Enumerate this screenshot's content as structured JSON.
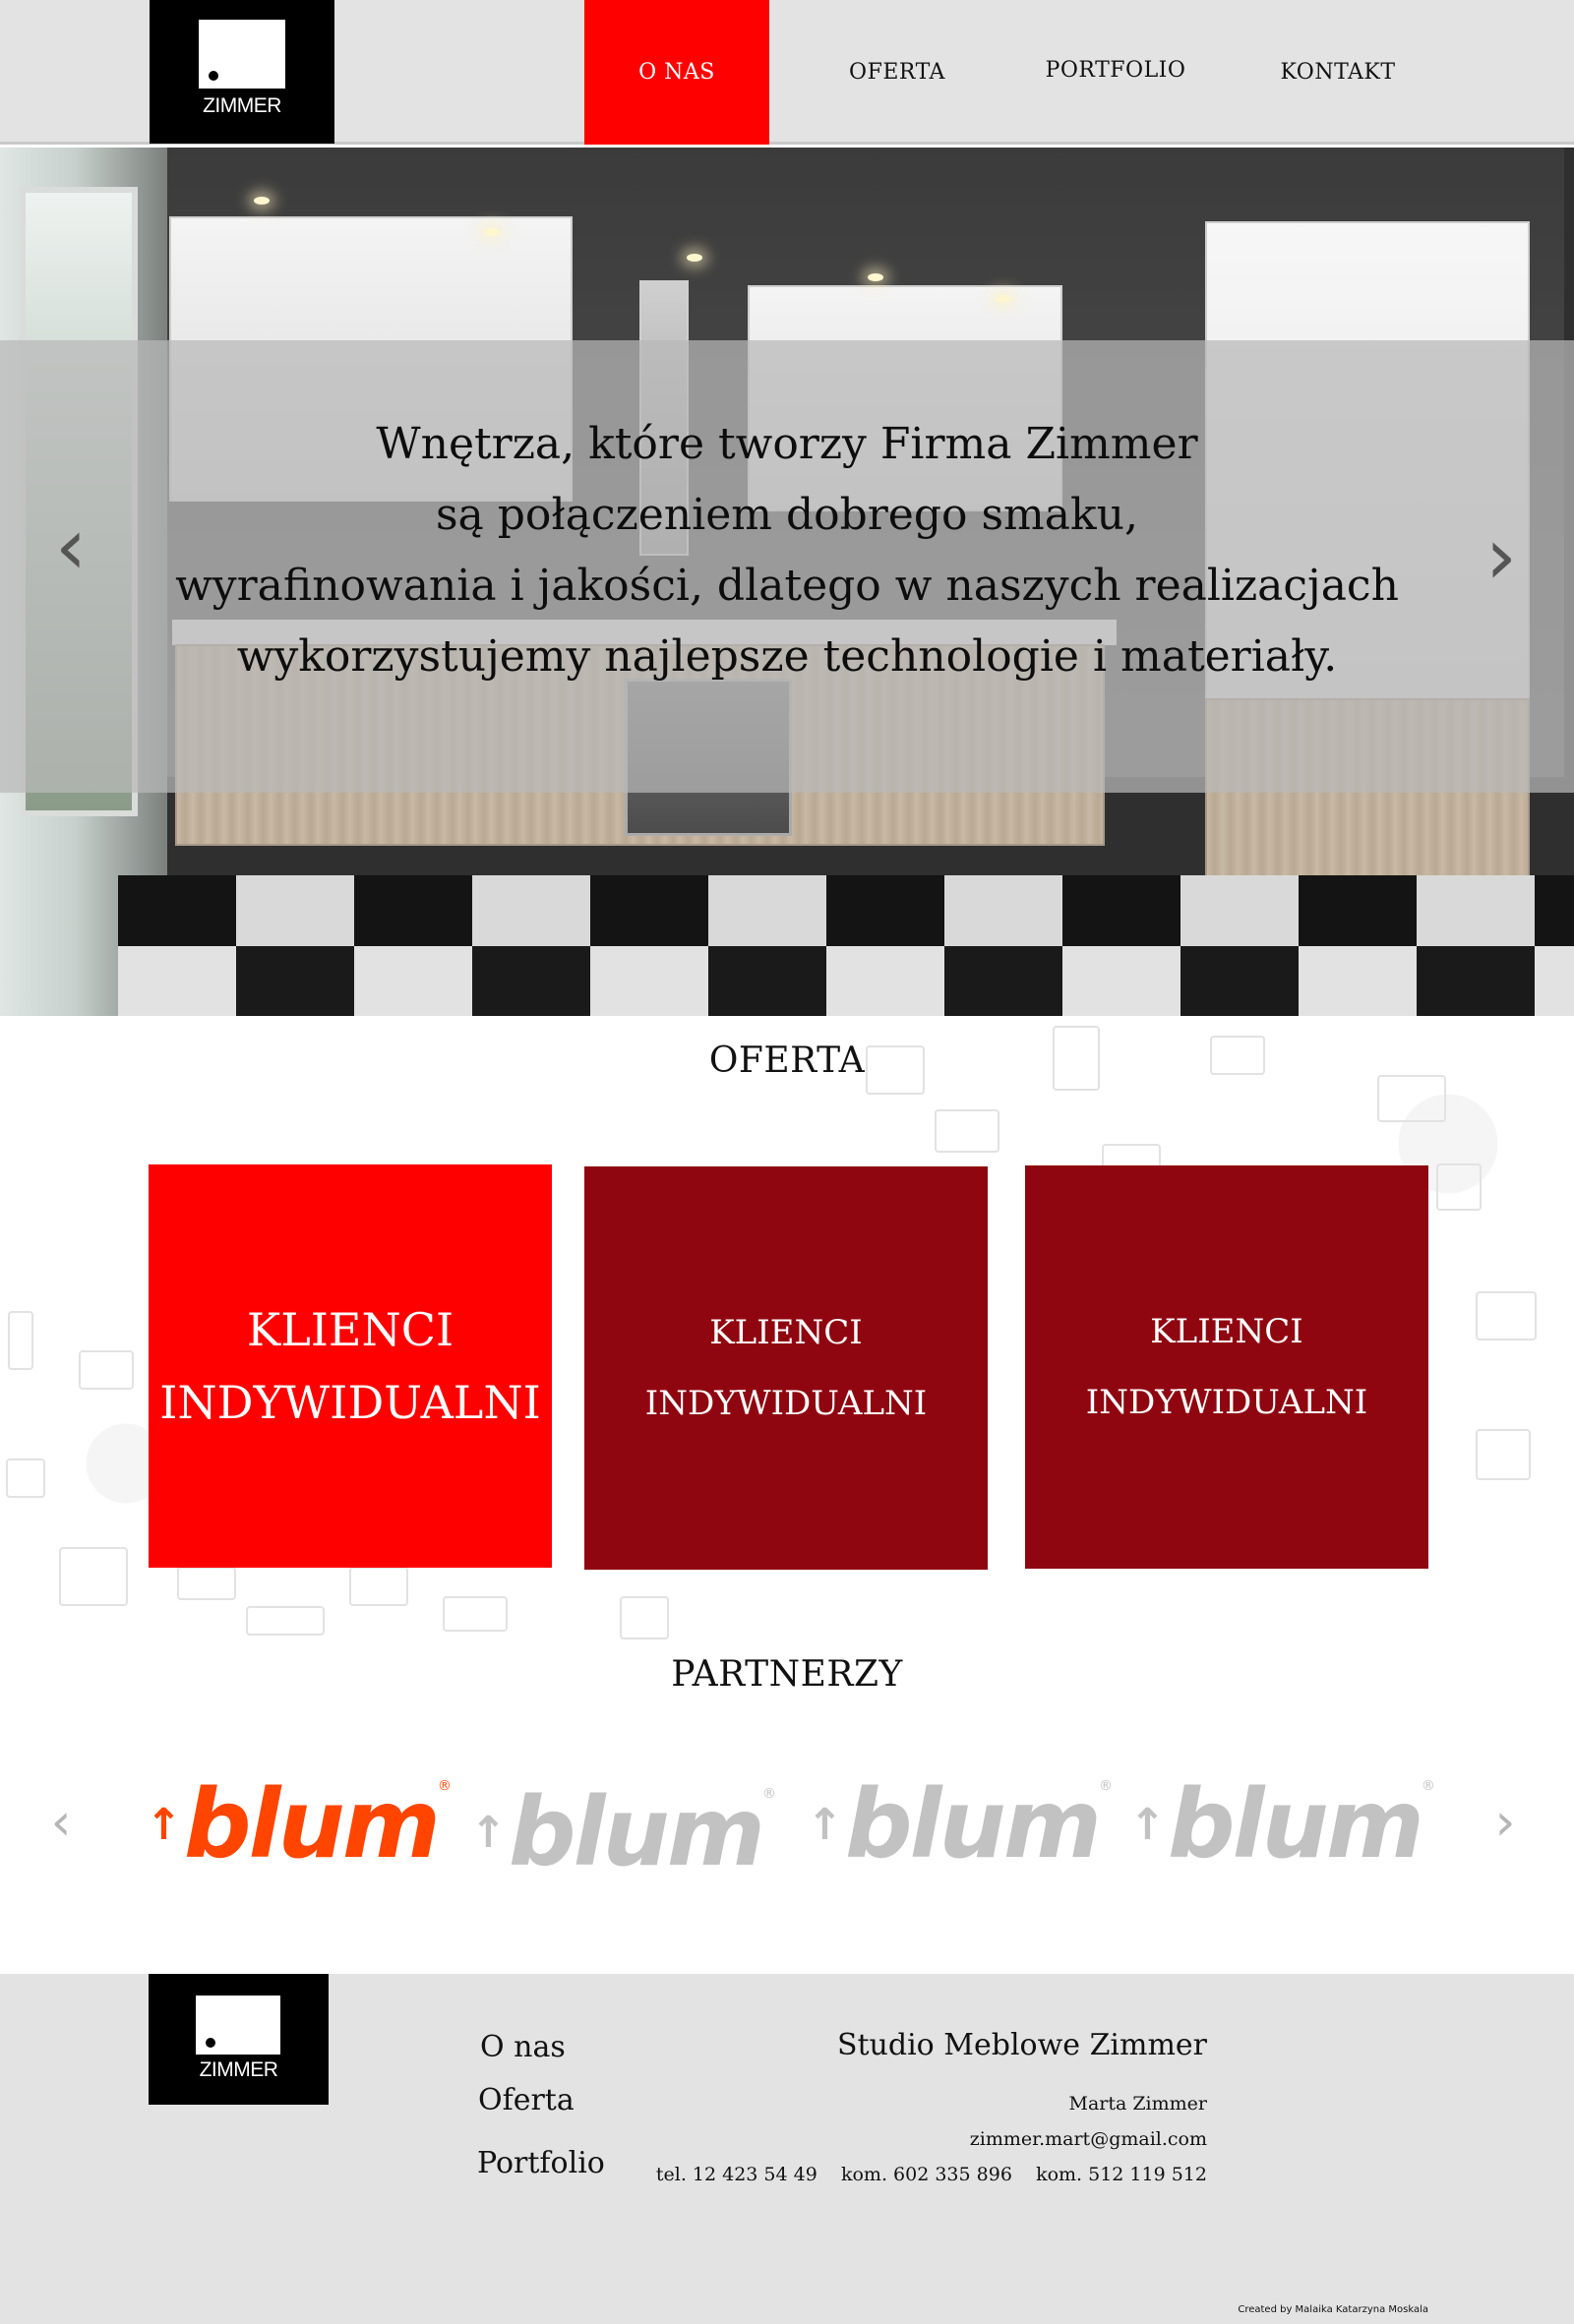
{
  "brand": {
    "logo_text": "ZIMMER"
  },
  "nav": {
    "items": [
      {
        "label": "O NAS",
        "active": true
      },
      {
        "label": "OFERTA",
        "active": false
      },
      {
        "label": "PORTFOLIO",
        "active": false
      },
      {
        "label": "KONTAKT",
        "active": false
      }
    ]
  },
  "hero": {
    "lines": [
      "Wnętrza, które tworzy Firma Zimmer",
      "są połączeniem dobrego smaku,",
      "wyrafinowania i jakości, dlatego w naszych realizacjach",
      "wykorzystujemy najlepsze technologie i materiały."
    ],
    "prev_icon": "chevron-left-icon",
    "next_icon": "chevron-right-icon"
  },
  "oferta": {
    "title": "OFERTA",
    "cards": [
      {
        "line1": "KLIENCI",
        "line2": "INDYWIDUALNI",
        "color": "#ff0000"
      },
      {
        "line1": "KLIENCI",
        "line2": "INDYWIDUALNI",
        "color": "#8f0610"
      },
      {
        "line1": "KLIENCI",
        "line2": "INDYWIDUALNI",
        "color": "#8f0610"
      }
    ]
  },
  "partners": {
    "title": "PARTNERZY",
    "logos": [
      {
        "name": "blum",
        "color": "#ff4500"
      },
      {
        "name": "blum",
        "color": "#c2c2c2"
      },
      {
        "name": "blum",
        "color": "#c2c2c2"
      },
      {
        "name": "blum",
        "color": "#c2c2c2"
      }
    ]
  },
  "footer": {
    "nav": [
      "O nas",
      "Oferta",
      "Portfolio"
    ],
    "company": "Studio Meblowe Zimmer",
    "contact_name": "Marta Zimmer",
    "email": "zimmer.mart@gmail.com",
    "phones": "tel. 12 423 54 49    kom. 602 335 896    kom. 512 119 512",
    "credit": "Created by Malaika Katarzyna Moskala"
  },
  "colors": {
    "accent_red": "#ff0000",
    "dark_red": "#8f0610",
    "header_gray": "#e3e3e3",
    "blum_orange": "#ff4500"
  }
}
